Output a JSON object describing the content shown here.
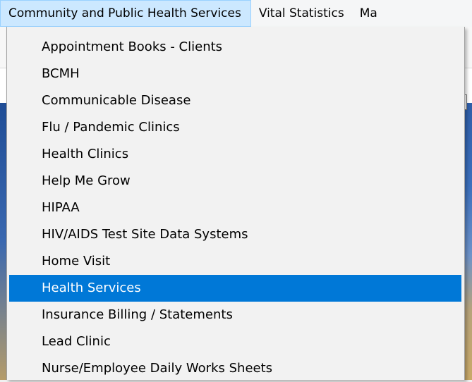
{
  "menubar": {
    "items": [
      {
        "label": "Community and Public Health Services"
      },
      {
        "label": "Vital Statistics"
      },
      {
        "label": "Ma"
      }
    ]
  },
  "dropdown": {
    "items": [
      {
        "label": "Appointment Books - Clients"
      },
      {
        "label": "BCMH"
      },
      {
        "label": "Communicable Disease"
      },
      {
        "label": "Flu / Pandemic Clinics"
      },
      {
        "label": "Health Clinics"
      },
      {
        "label": "Help Me Grow"
      },
      {
        "label": "HIPAA"
      },
      {
        "label": "HIV/AIDS Test Site Data Systems"
      },
      {
        "label": "Home Visit"
      },
      {
        "label": "Health Services"
      },
      {
        "label": "Insurance Billing / Statements"
      },
      {
        "label": "Lead Clinic"
      },
      {
        "label": "Nurse/Employee Daily Works Sheets"
      }
    ],
    "highlighted_label": "Health Services"
  },
  "colors": {
    "menubar_open_bg": "#cce8ff",
    "highlight_bg": "#0078d7",
    "menu_bg": "#f2f2f2"
  }
}
